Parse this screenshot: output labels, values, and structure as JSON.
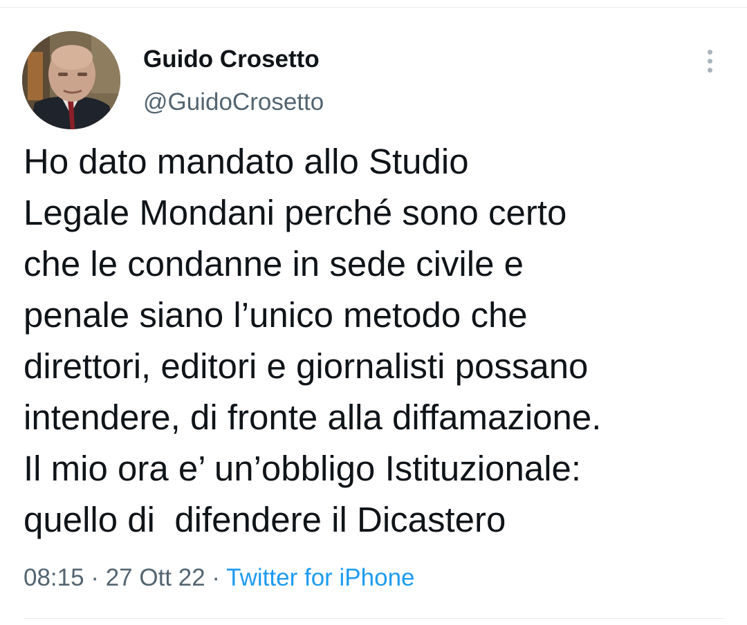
{
  "author": {
    "display_name": "Guido Crosetto",
    "handle": "@GuidoCrosetto"
  },
  "menu": {
    "icon": "more-vertical-icon"
  },
  "tweet": {
    "lines": [
      "Ho dato mandato allo Studio",
      "Legale Mondani perché sono certo",
      "che le condanne in sede civile e",
      "penale siano l’unico metodo che",
      "direttori, editori e giornalisti possano",
      "intendere, di fronte alla diffamazione.",
      "Il mio ora e’ un’obbligo Istituzionale:",
      "quello di  difendere il Dicastero"
    ]
  },
  "meta": {
    "time": "08:15",
    "separator": " · ",
    "date": "27 Ott 22",
    "source": "Twitter for iPhone"
  },
  "colors": {
    "text": "#0f1419",
    "secondary": "#536471",
    "link": "#1d9bf0",
    "divider": "#e6e9eb"
  }
}
